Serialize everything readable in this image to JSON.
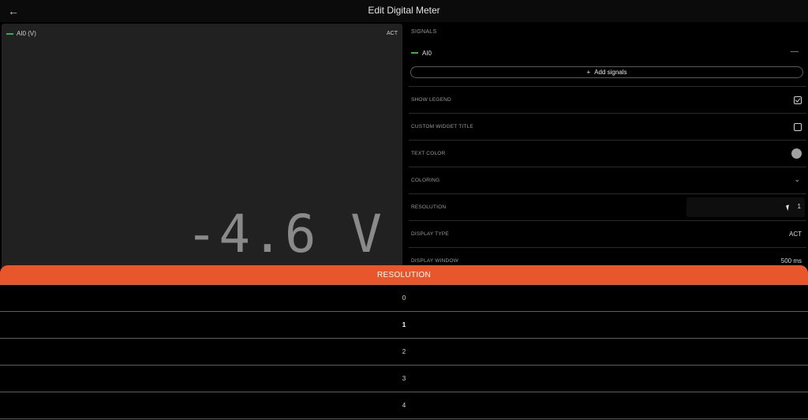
{
  "header": {
    "title": "Edit Digital Meter",
    "back_icon": "arrow-left-icon"
  },
  "preview": {
    "legend_label": "AI0 (V)",
    "badge": "ACT",
    "value": "-4.6 V",
    "colors": {
      "signal": "#3bb04a",
      "value_text": "#8a8a8a"
    }
  },
  "signals": {
    "section_label": "SIGNALS",
    "items": [
      {
        "name": "AI0",
        "color": "#3bb04a",
        "remove_icon": "minus-icon"
      }
    ],
    "add_label": "Add signals",
    "add_icon": "plus-icon"
  },
  "settings": {
    "show_legend": {
      "label": "SHOW LEGEND",
      "checked": true
    },
    "custom_title": {
      "label": "CUSTOM WIDGET TITLE",
      "checked": false
    },
    "text_color": {
      "label": "TEXT COLOR",
      "color": "#a0a0a0"
    },
    "coloring": {
      "label": "COLORING",
      "icon": "chevron-down-icon"
    },
    "resolution": {
      "label": "RESOLUTION",
      "value": "1"
    },
    "display_type": {
      "label": "DISPLAY TYPE",
      "value": "ACT"
    },
    "display_window": {
      "label": "DISPLAY WINDOW",
      "value": "500 ms"
    }
  },
  "picker": {
    "title": "RESOLUTION",
    "accent": "#e8572c",
    "options": [
      "0",
      "1",
      "2",
      "3",
      "4"
    ],
    "selected": "1"
  }
}
